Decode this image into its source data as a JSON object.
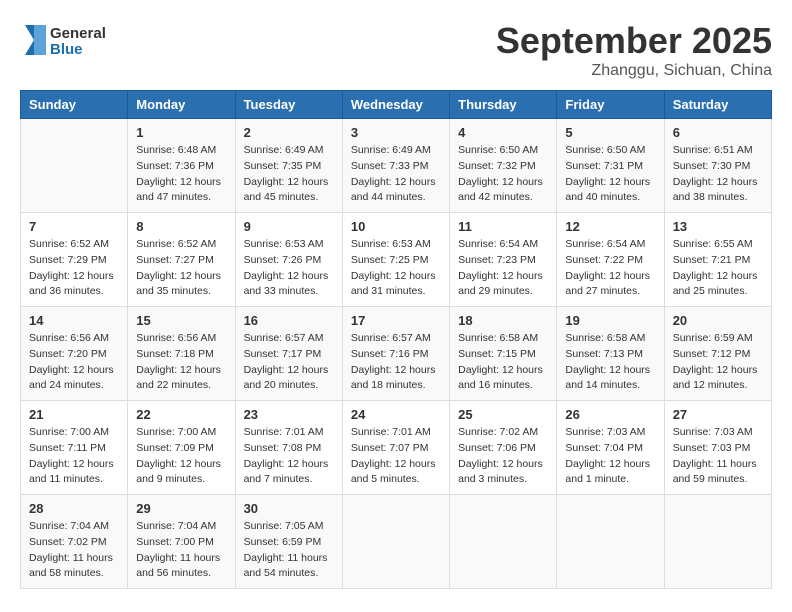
{
  "logo": {
    "general": "General",
    "blue": "Blue"
  },
  "title": "September 2025",
  "location": "Zhanggu, Sichuan, China",
  "weekdays": [
    "Sunday",
    "Monday",
    "Tuesday",
    "Wednesday",
    "Thursday",
    "Friday",
    "Saturday"
  ],
  "weeks": [
    [
      {
        "day": null
      },
      {
        "day": "1",
        "sunrise": "Sunrise: 6:48 AM",
        "sunset": "Sunset: 7:36 PM",
        "daylight": "Daylight: 12 hours and 47 minutes."
      },
      {
        "day": "2",
        "sunrise": "Sunrise: 6:49 AM",
        "sunset": "Sunset: 7:35 PM",
        "daylight": "Daylight: 12 hours and 45 minutes."
      },
      {
        "day": "3",
        "sunrise": "Sunrise: 6:49 AM",
        "sunset": "Sunset: 7:33 PM",
        "daylight": "Daylight: 12 hours and 44 minutes."
      },
      {
        "day": "4",
        "sunrise": "Sunrise: 6:50 AM",
        "sunset": "Sunset: 7:32 PM",
        "daylight": "Daylight: 12 hours and 42 minutes."
      },
      {
        "day": "5",
        "sunrise": "Sunrise: 6:50 AM",
        "sunset": "Sunset: 7:31 PM",
        "daylight": "Daylight: 12 hours and 40 minutes."
      },
      {
        "day": "6",
        "sunrise": "Sunrise: 6:51 AM",
        "sunset": "Sunset: 7:30 PM",
        "daylight": "Daylight: 12 hours and 38 minutes."
      }
    ],
    [
      {
        "day": "7",
        "sunrise": "Sunrise: 6:52 AM",
        "sunset": "Sunset: 7:29 PM",
        "daylight": "Daylight: 12 hours and 36 minutes."
      },
      {
        "day": "8",
        "sunrise": "Sunrise: 6:52 AM",
        "sunset": "Sunset: 7:27 PM",
        "daylight": "Daylight: 12 hours and 35 minutes."
      },
      {
        "day": "9",
        "sunrise": "Sunrise: 6:53 AM",
        "sunset": "Sunset: 7:26 PM",
        "daylight": "Daylight: 12 hours and 33 minutes."
      },
      {
        "day": "10",
        "sunrise": "Sunrise: 6:53 AM",
        "sunset": "Sunset: 7:25 PM",
        "daylight": "Daylight: 12 hours and 31 minutes."
      },
      {
        "day": "11",
        "sunrise": "Sunrise: 6:54 AM",
        "sunset": "Sunset: 7:23 PM",
        "daylight": "Daylight: 12 hours and 29 minutes."
      },
      {
        "day": "12",
        "sunrise": "Sunrise: 6:54 AM",
        "sunset": "Sunset: 7:22 PM",
        "daylight": "Daylight: 12 hours and 27 minutes."
      },
      {
        "day": "13",
        "sunrise": "Sunrise: 6:55 AM",
        "sunset": "Sunset: 7:21 PM",
        "daylight": "Daylight: 12 hours and 25 minutes."
      }
    ],
    [
      {
        "day": "14",
        "sunrise": "Sunrise: 6:56 AM",
        "sunset": "Sunset: 7:20 PM",
        "daylight": "Daylight: 12 hours and 24 minutes."
      },
      {
        "day": "15",
        "sunrise": "Sunrise: 6:56 AM",
        "sunset": "Sunset: 7:18 PM",
        "daylight": "Daylight: 12 hours and 22 minutes."
      },
      {
        "day": "16",
        "sunrise": "Sunrise: 6:57 AM",
        "sunset": "Sunset: 7:17 PM",
        "daylight": "Daylight: 12 hours and 20 minutes."
      },
      {
        "day": "17",
        "sunrise": "Sunrise: 6:57 AM",
        "sunset": "Sunset: 7:16 PM",
        "daylight": "Daylight: 12 hours and 18 minutes."
      },
      {
        "day": "18",
        "sunrise": "Sunrise: 6:58 AM",
        "sunset": "Sunset: 7:15 PM",
        "daylight": "Daylight: 12 hours and 16 minutes."
      },
      {
        "day": "19",
        "sunrise": "Sunrise: 6:58 AM",
        "sunset": "Sunset: 7:13 PM",
        "daylight": "Daylight: 12 hours and 14 minutes."
      },
      {
        "day": "20",
        "sunrise": "Sunrise: 6:59 AM",
        "sunset": "Sunset: 7:12 PM",
        "daylight": "Daylight: 12 hours and 12 minutes."
      }
    ],
    [
      {
        "day": "21",
        "sunrise": "Sunrise: 7:00 AM",
        "sunset": "Sunset: 7:11 PM",
        "daylight": "Daylight: 12 hours and 11 minutes."
      },
      {
        "day": "22",
        "sunrise": "Sunrise: 7:00 AM",
        "sunset": "Sunset: 7:09 PM",
        "daylight": "Daylight: 12 hours and 9 minutes."
      },
      {
        "day": "23",
        "sunrise": "Sunrise: 7:01 AM",
        "sunset": "Sunset: 7:08 PM",
        "daylight": "Daylight: 12 hours and 7 minutes."
      },
      {
        "day": "24",
        "sunrise": "Sunrise: 7:01 AM",
        "sunset": "Sunset: 7:07 PM",
        "daylight": "Daylight: 12 hours and 5 minutes."
      },
      {
        "day": "25",
        "sunrise": "Sunrise: 7:02 AM",
        "sunset": "Sunset: 7:06 PM",
        "daylight": "Daylight: 12 hours and 3 minutes."
      },
      {
        "day": "26",
        "sunrise": "Sunrise: 7:03 AM",
        "sunset": "Sunset: 7:04 PM",
        "daylight": "Daylight: 12 hours and 1 minute."
      },
      {
        "day": "27",
        "sunrise": "Sunrise: 7:03 AM",
        "sunset": "Sunset: 7:03 PM",
        "daylight": "Daylight: 11 hours and 59 minutes."
      }
    ],
    [
      {
        "day": "28",
        "sunrise": "Sunrise: 7:04 AM",
        "sunset": "Sunset: 7:02 PM",
        "daylight": "Daylight: 11 hours and 58 minutes."
      },
      {
        "day": "29",
        "sunrise": "Sunrise: 7:04 AM",
        "sunset": "Sunset: 7:00 PM",
        "daylight": "Daylight: 11 hours and 56 minutes."
      },
      {
        "day": "30",
        "sunrise": "Sunrise: 7:05 AM",
        "sunset": "Sunset: 6:59 PM",
        "daylight": "Daylight: 11 hours and 54 minutes."
      },
      {
        "day": null
      },
      {
        "day": null
      },
      {
        "day": null
      },
      {
        "day": null
      }
    ]
  ]
}
